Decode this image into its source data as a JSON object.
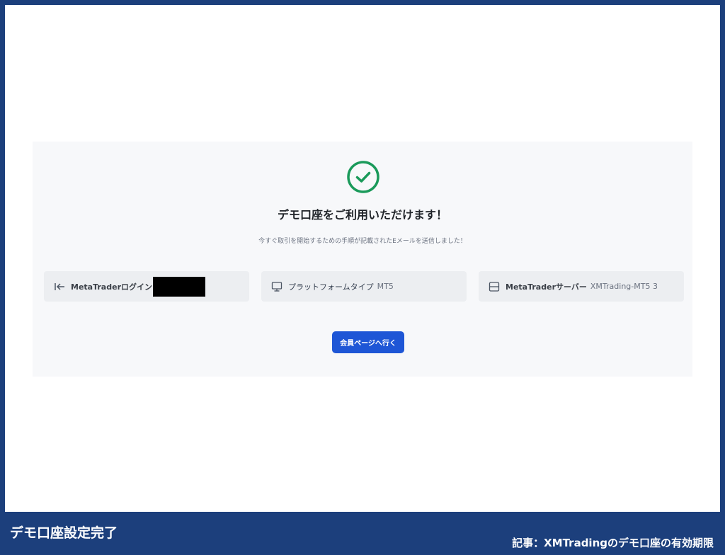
{
  "modal": {
    "heading": "デモ口座をご利用いただけます！",
    "subtext": "今すぐ取引を開始するための手順が記載されたEメールを送信しました！",
    "success_icon": "check-circle-icon",
    "success_color": "#1a9a5a"
  },
  "cards": {
    "login": {
      "label": "MetaTraderログイン",
      "icon": "arrow-bar-left-icon"
    },
    "platform": {
      "label": "プラットフォームタイプ",
      "value": "MT5",
      "icon": "monitor-icon"
    },
    "server": {
      "label": "MetaTraderサーバー",
      "value": "XMTrading-MT5 3",
      "icon": "server-icon"
    }
  },
  "button": {
    "label": "会員ページへ行く",
    "color": "#1e56d6"
  },
  "caption": {
    "left": "デモ口座設定完了",
    "right": "記事：XMTradingのデモ口座の有効期限"
  },
  "colors": {
    "frame": "#1c3f7c",
    "panel": "#f7f8fa"
  }
}
